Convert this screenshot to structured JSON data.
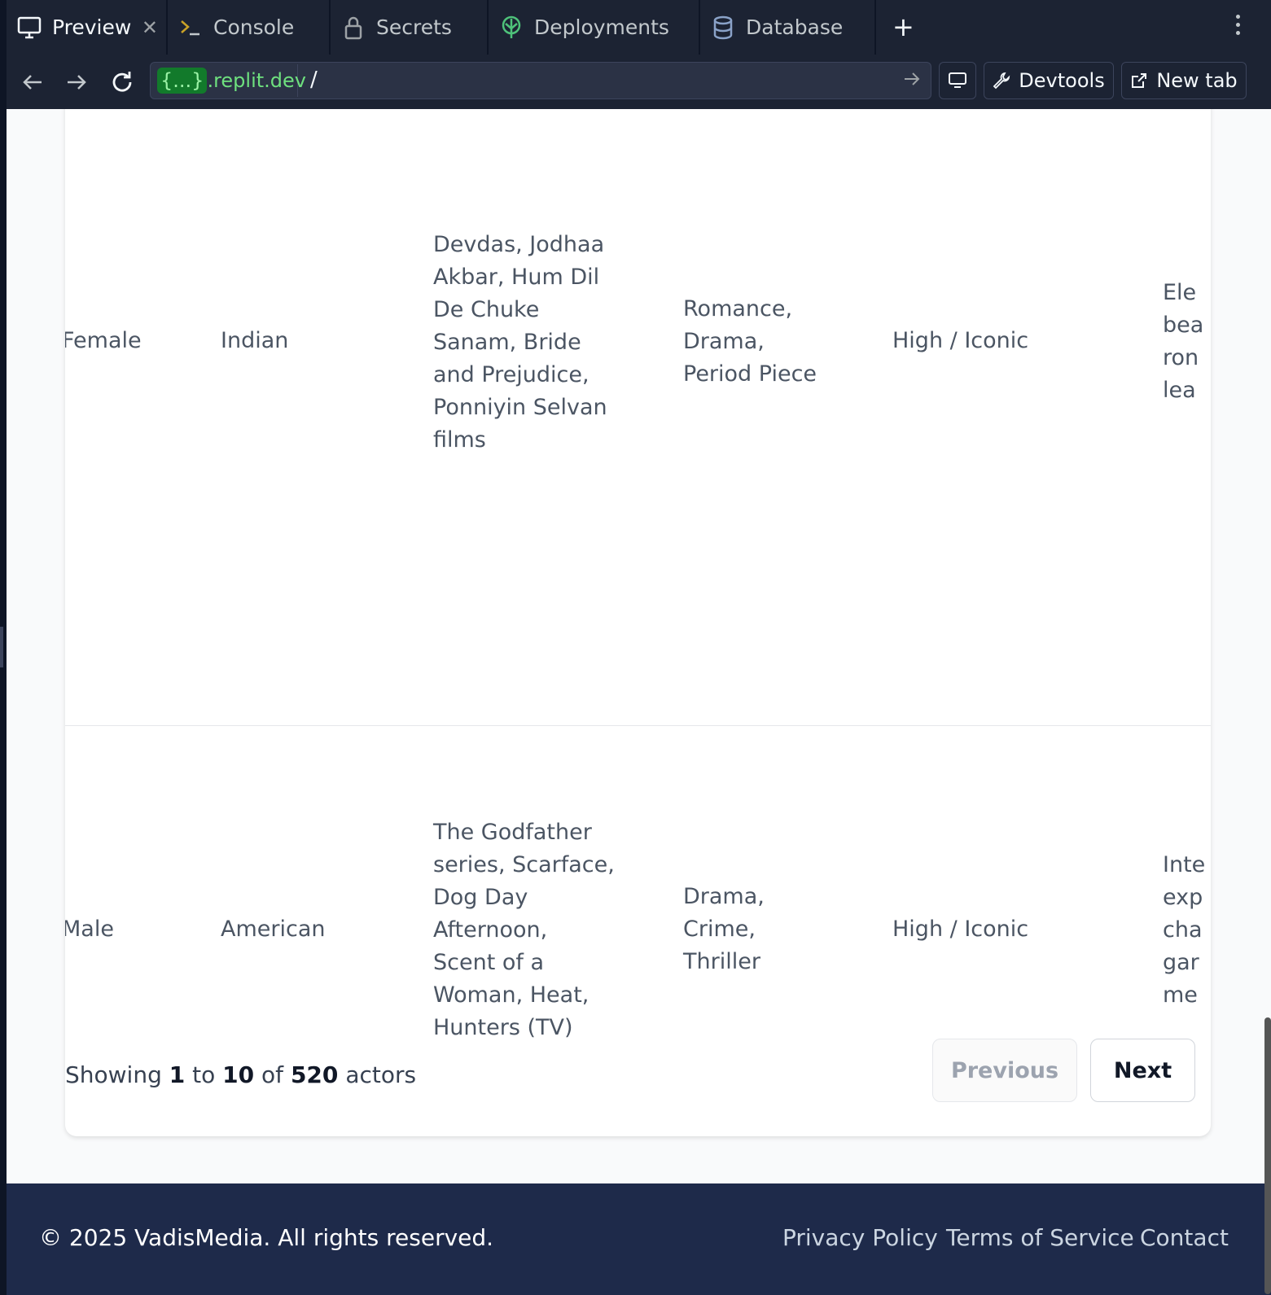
{
  "tabs": [
    {
      "label": "Preview",
      "icon": "monitor-icon",
      "active": true
    },
    {
      "label": "Console",
      "icon": "terminal-icon"
    },
    {
      "label": "Secrets",
      "icon": "lock-icon"
    },
    {
      "label": "Deployments",
      "icon": "deploy-icon"
    },
    {
      "label": "Database",
      "icon": "database-icon"
    }
  ],
  "address_bar": {
    "domain_braces": "{...}",
    "domain_suffix": ".replit.dev",
    "path": "/"
  },
  "toolbar": {
    "devtools_label": "Devtools",
    "newtab_label": "New tab"
  },
  "table": {
    "rows": [
      {
        "gender": "Female",
        "nationality": "Indian",
        "works": [
          "Devdas, Jodhaa",
          "Akbar, Hum Dil",
          "De Chuke",
          "Sanam, Bride",
          "and Prejudice,",
          "Ponniyin Selvan",
          "films"
        ],
        "genres": [
          "Romance,",
          "Drama,",
          "Period Piece"
        ],
        "popularity": "High / Iconic",
        "notes": [
          "Ele",
          "bea",
          "ron",
          "lea"
        ]
      },
      {
        "gender": "Male",
        "nationality": "American",
        "works": [
          "The Godfather",
          "series, Scarface,",
          "Dog Day",
          "Afternoon,",
          "Scent of a",
          "Woman, Heat,",
          "Hunters (TV)"
        ],
        "genres": [
          "Drama,",
          "Crime,",
          "Thriller"
        ],
        "popularity": "High / Iconic",
        "notes": [
          "Inte",
          "exp",
          "cha",
          "gar",
          "me"
        ]
      }
    ]
  },
  "pagination": {
    "prefix": "Showing",
    "from": "1",
    "to_word": "to",
    "to": "10",
    "of_word": "of",
    "total": "520",
    "suffix": "actors",
    "previous_label": "Previous",
    "next_label": "Next"
  },
  "footer": {
    "copyright": "© 2025 VadisMedia. All rights reserved.",
    "links": [
      "Privacy Policy",
      "Terms of Service",
      "Contact"
    ]
  }
}
